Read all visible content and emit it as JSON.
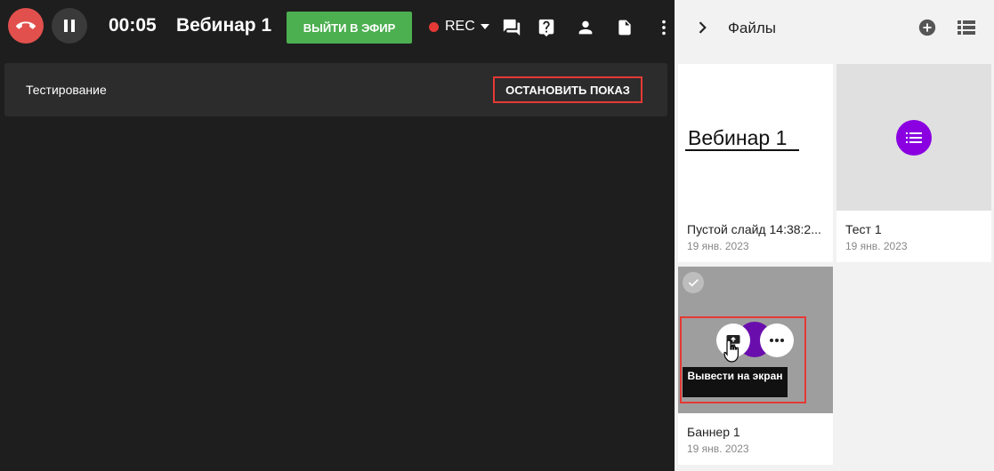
{
  "topbar": {
    "timer": "00:05",
    "title": "Вебинар 1",
    "live_button": "ВЫЙТИ В ЭФИР",
    "rec_label": "REC",
    "icons": [
      "end-call-icon",
      "pause-icon",
      "chat-icon",
      "question-icon",
      "user-icon",
      "file-icon",
      "more-vertical-icon"
    ],
    "colors": {
      "end_call": "#e2504d",
      "live": "#4caf50",
      "rec_dot": "#e53935",
      "accent_purple": "#8a00e0"
    }
  },
  "share": {
    "label": "Тестирование",
    "stop_button": "ОСТАНОВИТЬ ПОКАЗ"
  },
  "panel": {
    "title": "Файлы",
    "icons": [
      "chevron-right-icon",
      "add-circle-icon",
      "list-view-icon"
    ],
    "cards": [
      {
        "name": "Пустой слайд 14:38:2...",
        "date": "19 янв. 2023",
        "thumb_text": "Вебинар 1"
      },
      {
        "name": "Тест 1",
        "date": "19 янв. 2023"
      },
      {
        "name": "Баннер 1",
        "date": "19 янв. 2023"
      }
    ],
    "tooltip": "Вывести на экран"
  }
}
